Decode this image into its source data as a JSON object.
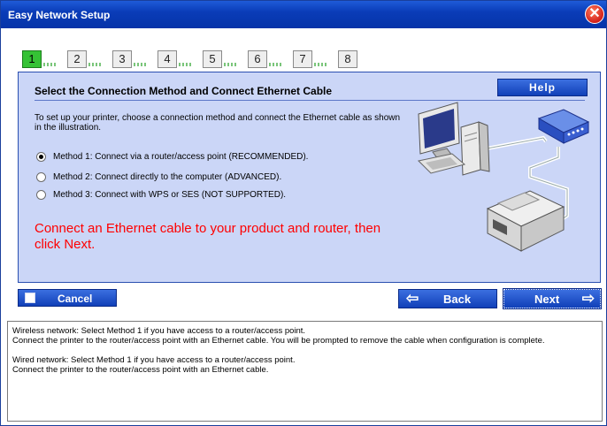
{
  "window": {
    "title": "Easy Network Setup",
    "close_label": "✕"
  },
  "steps": [
    {
      "label": "1",
      "active": true
    },
    {
      "label": "2",
      "active": false
    },
    {
      "label": "3",
      "active": false
    },
    {
      "label": "4",
      "active": false
    },
    {
      "label": "5",
      "active": false
    },
    {
      "label": "6",
      "active": false
    },
    {
      "label": "7",
      "active": false
    },
    {
      "label": "8",
      "active": false
    }
  ],
  "panel": {
    "heading": "Select the Connection Method and Connect Ethernet Cable",
    "help_label": "Help",
    "intro": "To set up your printer, choose a connection method and connect the Ethernet cable as shown in the illustration.",
    "methods": [
      {
        "label": "Method 1: Connect via a router/access point (RECOMMENDED).",
        "checked": true
      },
      {
        "label": "Method 2: Connect directly to the computer (ADVANCED).",
        "checked": false
      },
      {
        "label": "Method 3: Connect with WPS or SES (NOT SUPPORTED).",
        "checked": false
      }
    ],
    "alert": "Connect an Ethernet cable to your product and router, then click Next."
  },
  "buttons": {
    "cancel": "Cancel",
    "back": "Back",
    "next": "Next"
  },
  "info": {
    "wireless_line1": "Wireless network: Select Method 1 if you have access to a router/access point.",
    "wireless_line2": "Connect the printer to the router/access point with an Ethernet cable. You will be prompted to remove the cable when configuration is complete.",
    "wired_line1": "Wired network: Select Method 1 if you have access to a router/access point.",
    "wired_line2": "Connect the printer to the router/access point with an Ethernet cable."
  },
  "colors": {
    "titlebar": "#0a3cb8",
    "panel_bg": "#cbd6f7",
    "alert": "#ff0000",
    "active_step": "#35c235"
  }
}
